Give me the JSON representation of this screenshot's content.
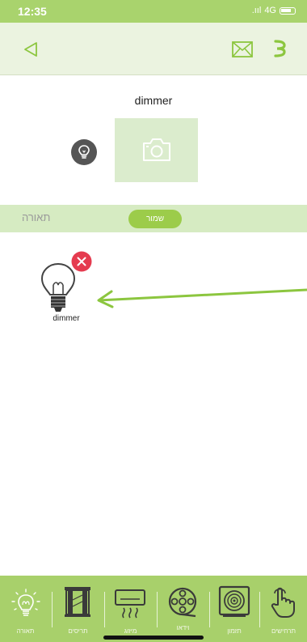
{
  "status_bar": {
    "time": "12:35",
    "signal": ".ııl",
    "network": "4G",
    "battery": "battery-icon"
  },
  "header": {
    "back": "back-icon",
    "mail": "mail-icon",
    "menu": "menu-icon"
  },
  "device": {
    "title": "dimmer",
    "type_icon": "lightbulb-icon",
    "photo_icon": "camera-icon"
  },
  "section": {
    "label": "תאורה",
    "save_label": "שמור"
  },
  "items": [
    {
      "label": "dimmer",
      "icon": "lightbulb-icon",
      "remove": "remove-icon"
    }
  ],
  "annotation": {
    "icon": "arrow-icon",
    "color": "#8cc63f"
  },
  "bottom_nav": [
    {
      "label": "תאורה",
      "icon": "lightbulb-icon"
    },
    {
      "label": "תריסים",
      "icon": "blinds-icon"
    },
    {
      "label": "מיזוג",
      "icon": "air-conditioner-icon"
    },
    {
      "label": "וידאו",
      "icon": "video-icon"
    },
    {
      "label": "תזמון",
      "icon": "timer-icon"
    },
    {
      "label": "תרחישים",
      "icon": "scenes-icon"
    }
  ],
  "colors": {
    "primary": "#a9d36d",
    "header_bg": "#ebf3e0",
    "section_bg": "#d6ebc2",
    "save_button": "#9ccc4a",
    "photo_bg": "#dbeccd"
  }
}
